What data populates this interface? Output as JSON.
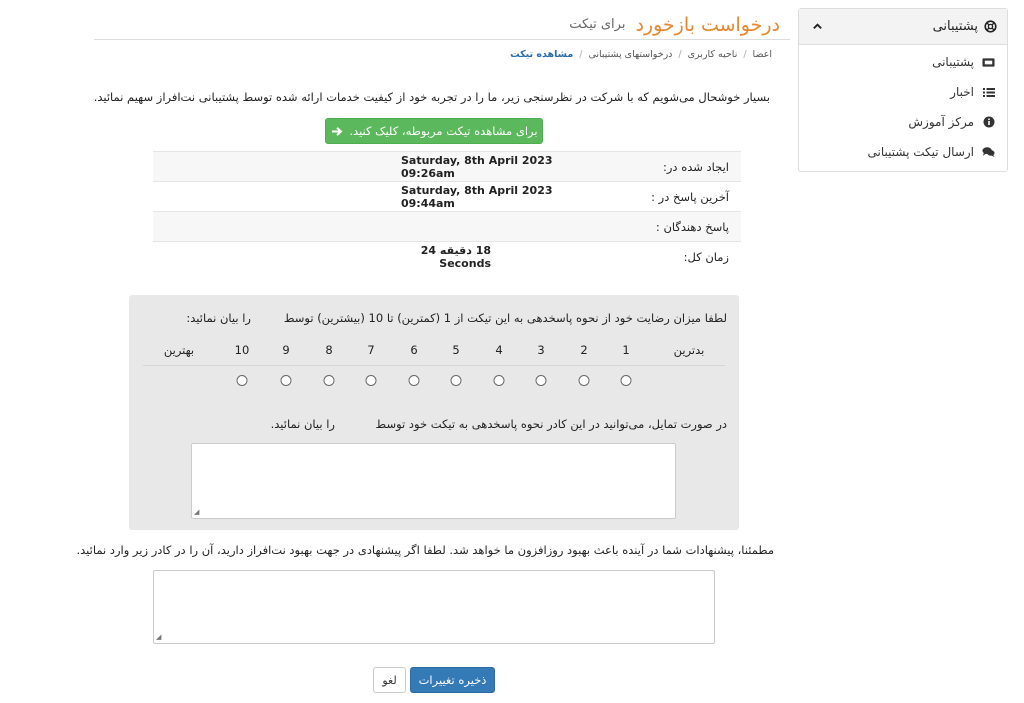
{
  "header": {
    "title": "درخواست بازخورد",
    "subtitle": "برای تیکت"
  },
  "breadcrumb": {
    "items": [
      "اعضا",
      "ناحیه کاربری",
      "درخواستهای پشتیبانی",
      "مشاهده تیکت"
    ],
    "separator": "/"
  },
  "intro_text": "بسیار خوشحال می‌شویم که با شرکت در نظرسنجی زیر، ما را در تجربه خود از کیفیت خدمات ارائه شده توسط پشتیبانی نت‌افراز سهیم نمائید.",
  "view_ticket_button": "برای مشاهده تیکت مربوطه، کلیک کنید.",
  "ticket_info": [
    {
      "label": "ایجاد شده در:",
      "value": "Saturday, 8th April 2023 09:26am"
    },
    {
      "label": "آخرین پاسخ در :",
      "value": "Saturday, 8th April 2023 09:44am"
    },
    {
      "label": "پاسخ دهندگان :",
      "value": ""
    },
    {
      "label": "زمان کل:",
      "value": "18 دقیقه 24 Seconds"
    }
  ],
  "rating": {
    "question": "لطفا میزان رضایت خود از نحوه پاسخدهی به این تیکت از 1 (کمترین) تا 10 (بیشترین) توسط",
    "question_tail": "را بیان نمائید:",
    "worst_label": "بدترین",
    "best_label": "بهترین",
    "scale": [
      "1",
      "2",
      "3",
      "4",
      "5",
      "6",
      "7",
      "8",
      "9",
      "10"
    ]
  },
  "comment": {
    "question": "در صورت تمایل، می‌توانید در این کادر نحوه پاسخدهی به تیکت خود توسط",
    "question_tail": "را بیان نمائید."
  },
  "suggestion_text": "مطمئنا، پیشنهادات شما در آینده باعث بهبود روزافزون ما خواهد شد. لطفا اگر پیشنهادی در جهت بهبود نت‌افراز دارید، آن را در کادر زیر وارد نمائید.",
  "buttons": {
    "save": "ذخیره تغییرات",
    "cancel": "لغو"
  },
  "sidebar": {
    "title": "پشتیبانی",
    "items": [
      {
        "label": "پشتیبانی",
        "icon": "ticket-icon"
      },
      {
        "label": "اخبار",
        "icon": "list-icon"
      },
      {
        "label": "مرکز آموزش",
        "icon": "info-icon"
      },
      {
        "label": "ارسال تیکت پشتیبانی",
        "icon": "comments-icon"
      }
    ]
  },
  "colors": {
    "title": "#e8862e",
    "green_button": "#5cb85c",
    "save_button": "#337ab7",
    "breadcrumb_active": "#2a6aa8"
  }
}
